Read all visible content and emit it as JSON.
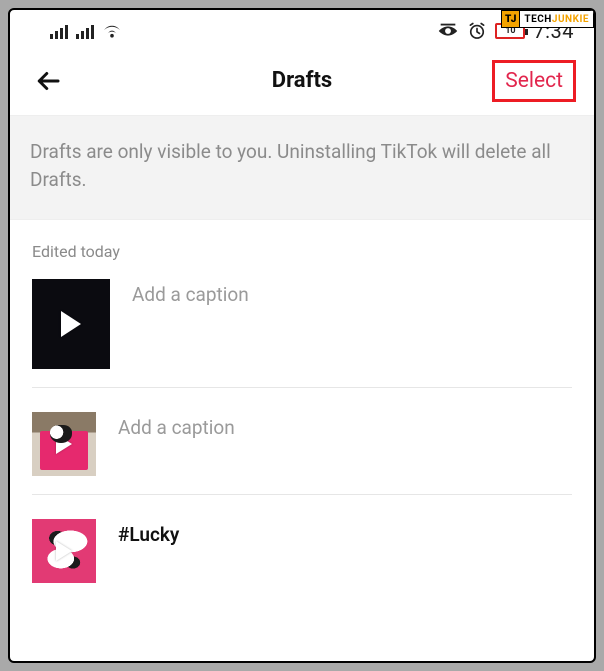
{
  "watermark": {
    "logo": "TJ",
    "brand_a": "TECH",
    "brand_b": "JUNKIE"
  },
  "status": {
    "battery_level": "10",
    "time": "7:34"
  },
  "header": {
    "title": "Drafts",
    "select_label": "Select"
  },
  "notice": "Drafts are only visible to you. Uninstalling TikTok will delete all Drafts.",
  "section_heading": "Edited today",
  "drafts": [
    {
      "caption": "Add a caption",
      "is_placeholder": true
    },
    {
      "caption": "Add a caption",
      "is_placeholder": true
    },
    {
      "caption": "#Lucky",
      "is_placeholder": false
    }
  ]
}
